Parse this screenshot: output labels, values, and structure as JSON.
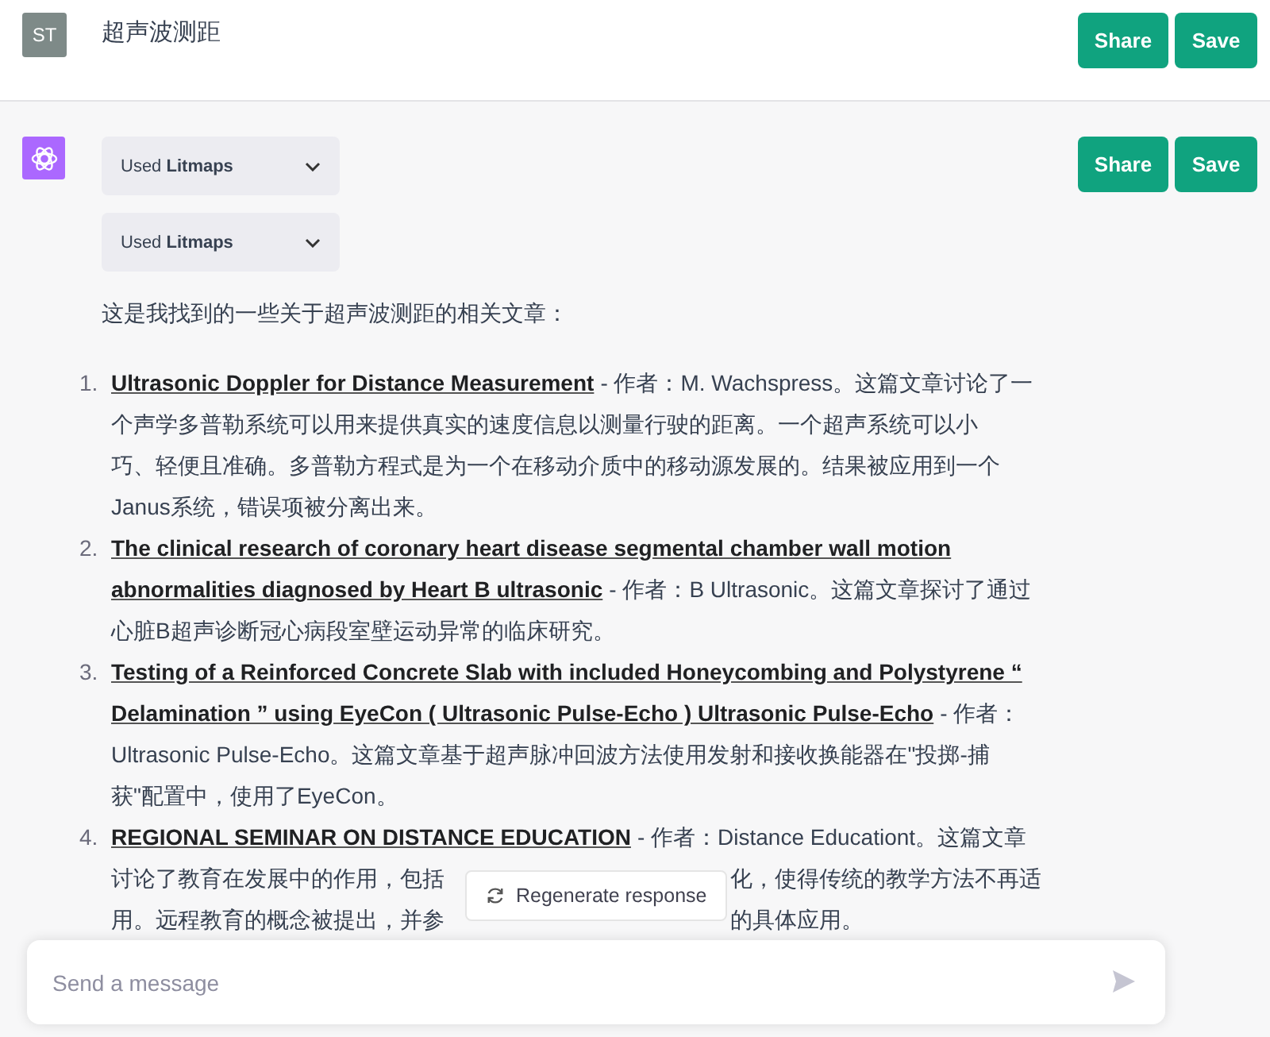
{
  "conversation_title": "超声波测距",
  "user_avatar": "ST",
  "header_buttons": [
    "Share",
    "Save"
  ],
  "response": {
    "tools": [
      {
        "prefix": "Used",
        "name": "Litmaps",
        "expanded": false
      },
      {
        "prefix": "Used",
        "name": "Litmaps",
        "expanded": false
      }
    ],
    "buttons": [
      "Share",
      "Save"
    ],
    "intro": "这是我找到的一些关于超声波测距的相关文章：",
    "articles": [
      {
        "number": "1.",
        "lines": [
          [
            {
              "kind": "title",
              "text": "Ultrasonic Doppler for Distance Measurement"
            },
            {
              "kind": "text",
              "text": "- 作者：M. Wachspress。这篇文章讨论了一"
            }
          ],
          [
            {
              "kind": "text",
              "text": "个声学多普勒系统可以用来提供真实的速度信息以测量行驶的距离。一个超声系统可以小"
            }
          ],
          [
            {
              "kind": "text",
              "text": "巧、轻便且准确。多普勒方程式是为一个在移动介质中的移动源发展的。结果被应用到一个"
            }
          ],
          [
            {
              "kind": "text",
              "text": "Janus系统，错误项被分离出来。"
            }
          ]
        ]
      },
      {
        "number": "2.",
        "lines": [
          [
            {
              "kind": "title",
              "text": "The clinical research of coronary heart disease segmental chamber wall motion"
            }
          ],
          [
            {
              "kind": "title",
              "text": "abnormalities diagnosed by Heart B ultrasonic"
            },
            {
              "kind": "text",
              "text": "- 作者：B Ultrasonic。这篇文章探讨了通过"
            }
          ],
          [
            {
              "kind": "text",
              "text": "心脏B超声诊断冠心病段室壁运动异常的临床研究。"
            }
          ]
        ]
      },
      {
        "number": "3.",
        "lines": [
          [
            {
              "kind": "title",
              "text": "Testing of a Reinforced Concrete Slab with included Honeycombing and Polystyrene “"
            }
          ],
          [
            {
              "kind": "title",
              "text": "Delamination ” using EyeCon ( Ultrasonic Pulse-Echo ) Ultrasonic Pulse-Echo"
            },
            {
              "kind": "text",
              "text": "- 作者："
            }
          ],
          [
            {
              "kind": "text",
              "text": "Ultrasonic Pulse-Echo。这篇文章基于超声脉冲回波方法使用发射和接收换能器在\"投掷-捕"
            }
          ],
          [
            {
              "kind": "text",
              "text": "获\"配置中，使用了EyeCon。"
            }
          ]
        ]
      },
      {
        "number": "4.",
        "lines": [
          [
            {
              "kind": "title",
              "text": "REGIONAL SEMINAR ON DISTANCE EDUCATION"
            },
            {
              "kind": "text",
              "text": "- 作者：Distance Educationt。这篇文章"
            }
          ],
          [
            {
              "kind": "text",
              "text": "讨论了教育在发展中的作用，包括"
            },
            {
              "kind": "text",
              "text": "化，使得传统的教学方法不再适"
            }
          ],
          [
            {
              "kind": "text",
              "text": "用。远程教育的概念被提出，并参"
            },
            {
              "kind": "text",
              "text": "的具体应用。"
            }
          ]
        ]
      }
    ]
  },
  "regenerate_button": "Regenerate response",
  "message_field": {
    "placeholder": "Send a message"
  }
}
